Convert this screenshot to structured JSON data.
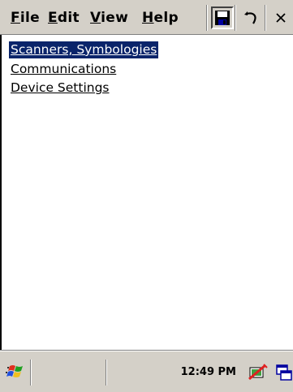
{
  "menubar": {
    "file": {
      "first": "F",
      "rest": "ile"
    },
    "edit": {
      "first": "E",
      "rest": "dit"
    },
    "view": {
      "first": "V",
      "rest": "iew"
    },
    "help": {
      "first": "H",
      "rest": "elp"
    }
  },
  "toolbar": {
    "save_icon": "save-icon",
    "undo_icon": "undo-icon",
    "close_icon": "close-icon",
    "close_glyph": "×"
  },
  "tree": {
    "items": [
      {
        "label": "Scanners, Symbologies",
        "selected": true
      },
      {
        "label": "Communications",
        "selected": false
      },
      {
        "label": "Device Settings",
        "selected": false
      }
    ]
  },
  "taskbar": {
    "clock": "12:49 PM",
    "start_icon": "windows-flag-icon",
    "tray_icons": [
      "connectivity-icon",
      "switch-windows-icon"
    ]
  },
  "colors": {
    "selection": "#0a246a",
    "chrome": "#d4d0c8"
  }
}
